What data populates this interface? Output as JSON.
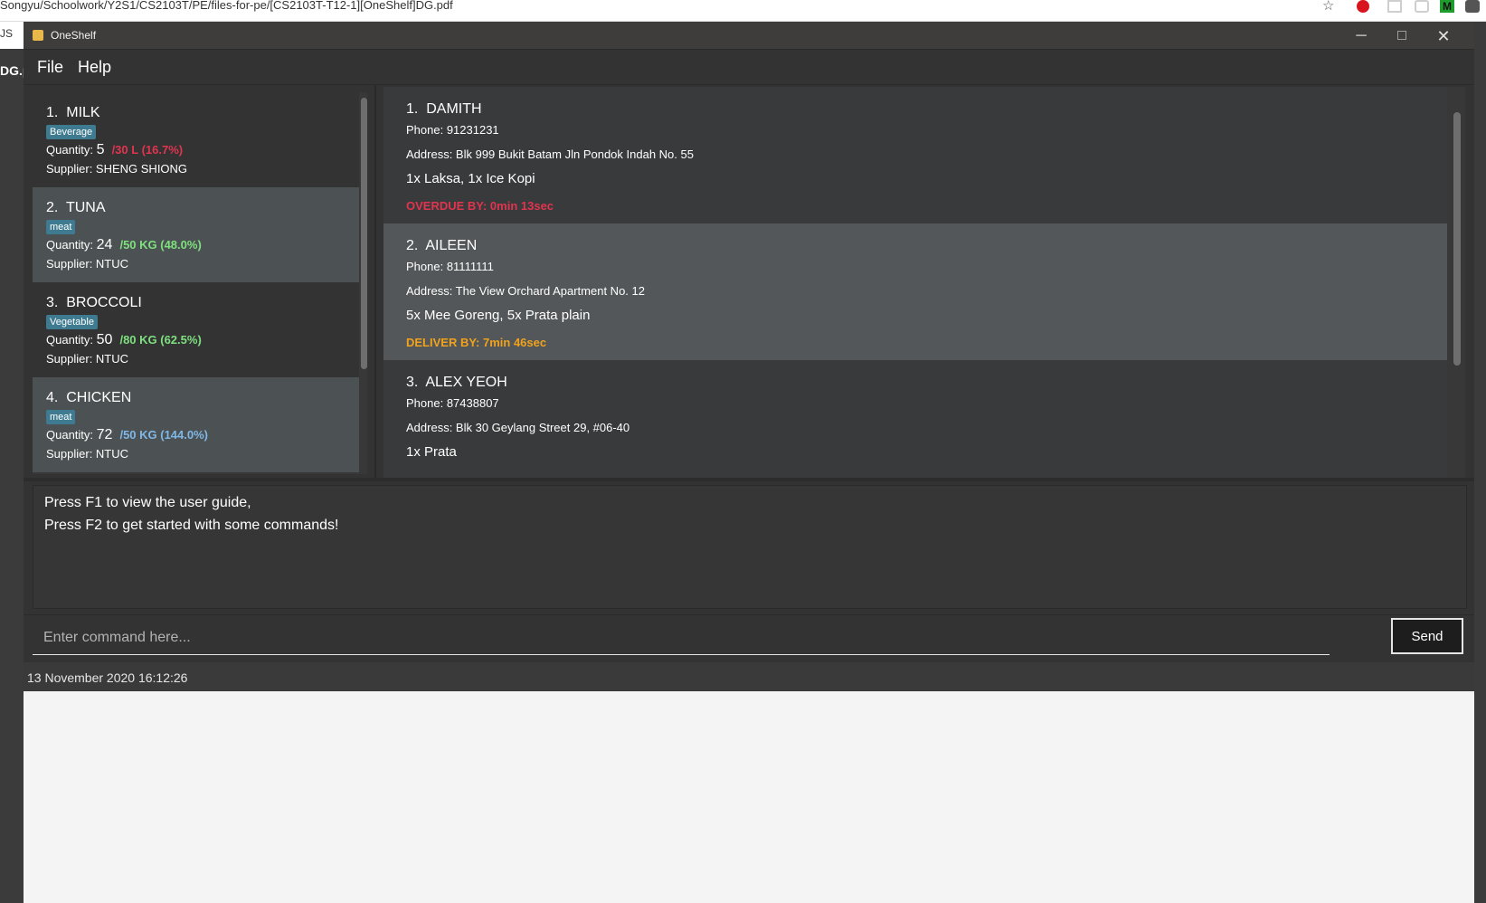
{
  "browser": {
    "path_text": "Songyu/Schoolwork/Y2S1/CS2103T/PE/files-for-pe/[CS2103T-T12-1][OneShelf]DG.pdf",
    "left_tab_text": "JS",
    "left_doc_text": "DG.p"
  },
  "window": {
    "title": "OneShelf",
    "minimize_label": "─",
    "close_label": "✕"
  },
  "menu": {
    "file_label": "File",
    "help_label": "Help"
  },
  "items": [
    {
      "index": "1.",
      "name": "MILK",
      "tag": "Beverage",
      "quantity_label": "Quantity:",
      "quantity": "5",
      "ratio": "/30 L (16.7%)",
      "ratio_color": "#e0344f",
      "supplier": "Supplier: SHENG SHIONG"
    },
    {
      "index": "2.",
      "name": "TUNA",
      "tag": "meat",
      "quantity_label": "Quantity:",
      "quantity": "24",
      "ratio": "/50 KG (48.0%)",
      "ratio_color": "#7ee07e",
      "supplier": "Supplier: NTUC"
    },
    {
      "index": "3.",
      "name": "BROCCOLI",
      "tag": "Vegetable",
      "quantity_label": "Quantity:",
      "quantity": "50",
      "ratio": "/80 KG (62.5%)",
      "ratio_color": "#7ee07e",
      "supplier": "Supplier: NTUC"
    },
    {
      "index": "4.",
      "name": "CHICKEN",
      "tag": "meat",
      "quantity_label": "Quantity:",
      "quantity": "72",
      "ratio": "/50 KG (144.0%)",
      "ratio_color": "#7fb8e6",
      "supplier": "Supplier: NTUC"
    }
  ],
  "deliveries": [
    {
      "index": "1.",
      "name": "DAMITH",
      "phone": "Phone: 91231231",
      "address": "Address: Blk 999 Bukit Batam Jln Pondok Indah No. 55",
      "order": "1x Laksa, 1x Ice Kopi",
      "status": "OVERDUE BY: 0min 13sec",
      "status_color": "#e0344f"
    },
    {
      "index": "2.",
      "name": "AILEEN",
      "phone": "Phone: 81111111",
      "address": "Address: The View Orchard Apartment No. 12",
      "order": "5x Mee Goreng, 5x Prata plain",
      "status": "DELIVER BY: 7min 46sec",
      "status_color": "#f0a21c"
    },
    {
      "index": "3.",
      "name": "ALEX YEOH",
      "phone": "Phone: 87438807",
      "address": "Address: Blk 30 Geylang Street 29, #06-40",
      "order": "1x Prata",
      "status": "",
      "status_color": "#f0a21c"
    }
  ],
  "result": {
    "line1": "Press F1 to view the user guide,",
    "line2": "Press F2 to get started with some commands!"
  },
  "command": {
    "placeholder": "Enter command here...",
    "value": "",
    "send_label": "Send"
  },
  "status": {
    "timestamp": "13 November 2020 16:12:26"
  },
  "colors": {
    "tag_bg": "#3e7b91",
    "overdue": "#e0344f",
    "deliver_by": "#f0a21c",
    "ok_ratio": "#7ee07e",
    "over_ratio": "#7fb8e6"
  }
}
